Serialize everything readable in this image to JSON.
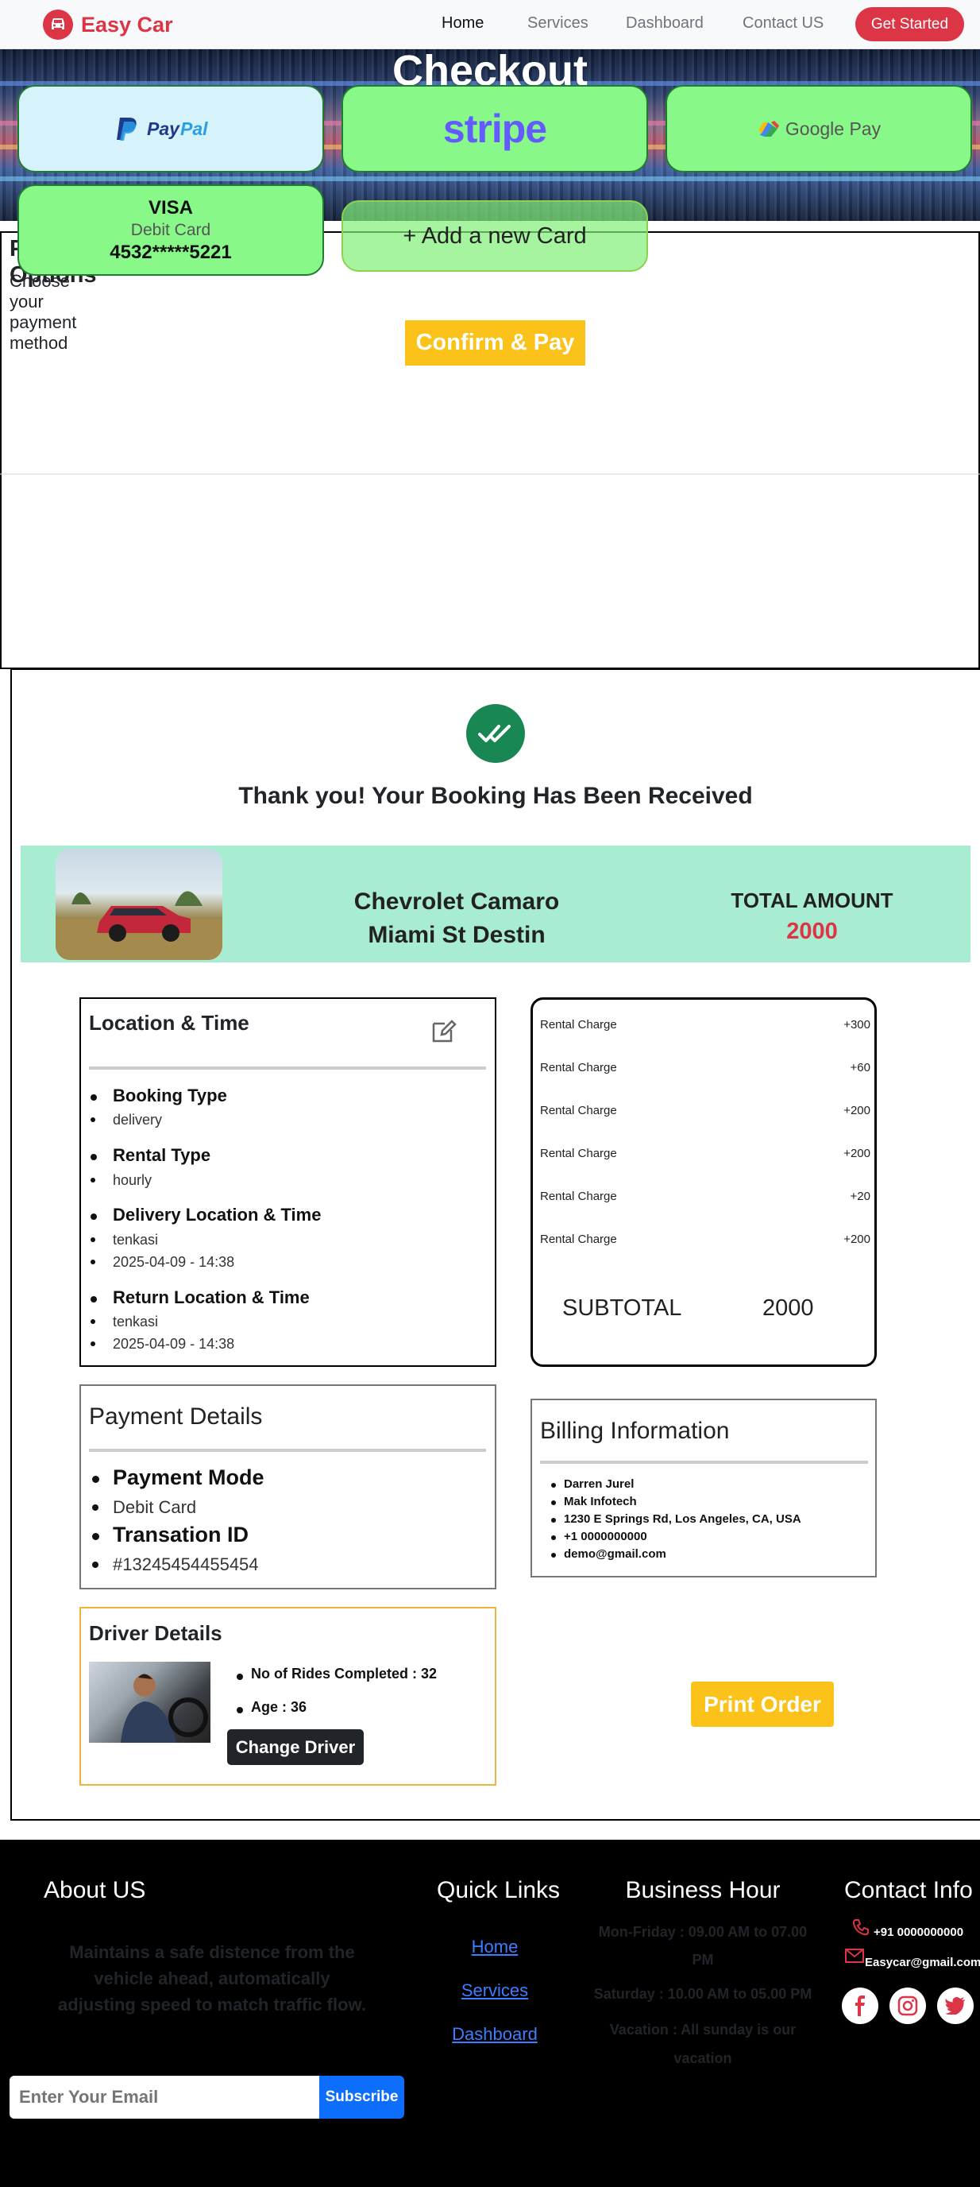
{
  "nav": {
    "brand": "Easy Car",
    "links": [
      "Home",
      "Services",
      "Dashboard",
      "Contact US"
    ],
    "cta": "Get Started"
  },
  "hero": {
    "title": "Checkout"
  },
  "payment": {
    "title": "Payment Options",
    "subtitle": "Choose your payment method",
    "methods": {
      "paypal": "PayPal",
      "stripe": "stripe",
      "gpay": "Google Pay"
    },
    "card": {
      "brand": "VISA",
      "type": "Debit Card",
      "number": "4532*****5221"
    },
    "add_card": "+ Add a new Card",
    "confirm": "Confirm & Pay"
  },
  "order": {
    "thanks": "Thank you! Your Booking Has Been Received",
    "car_name": "Chevrolet Camaro",
    "car_location": "Miami St Destin",
    "total_label": "TOTAL AMOUNT",
    "total_amount": "2000"
  },
  "location_time": {
    "title": "Location & Time",
    "sections": [
      {
        "heading": "Booking Type",
        "values": [
          "delivery"
        ]
      },
      {
        "heading": "Rental Type",
        "values": [
          "hourly"
        ]
      },
      {
        "heading": "Delivery Location & Time",
        "values": [
          "tenkasi",
          "2025-04-09 - 14:38"
        ]
      },
      {
        "heading": "Return Location & Time",
        "values": [
          "tenkasi",
          "2025-04-09 - 14:38"
        ]
      }
    ]
  },
  "charges": {
    "rows": [
      {
        "label": "Rental Charge",
        "value": "+300"
      },
      {
        "label": "Rental Charge",
        "value": "+60"
      },
      {
        "label": "Rental Charge",
        "value": "+200"
      },
      {
        "label": "Rental Charge",
        "value": "+200"
      },
      {
        "label": "Rental Charge",
        "value": "+20"
      },
      {
        "label": "Rental Charge",
        "value": "+200"
      }
    ],
    "subtotal_label": "SUBTOTAL",
    "subtotal_value": "2000"
  },
  "payment_details": {
    "title": "Payment Details",
    "mode_label": "Payment Mode",
    "mode_value": "Debit Card",
    "txn_label": "Transation ID",
    "txn_value": "#13245454455454"
  },
  "billing": {
    "title": "Billing Information",
    "lines": [
      "Darren Jurel",
      "Mak Infotech",
      "1230 E Springs Rd, Los Angeles, CA, USA",
      "+1 0000000000",
      "demo@gmail.com"
    ]
  },
  "driver": {
    "title": "Driver Details",
    "rides": "No of Rides Completed : 32",
    "age": "Age : 36",
    "change": "Change Driver"
  },
  "print": "Print Order",
  "footer": {
    "about_title": "About US",
    "about_text": "Maintains a safe distence from the vehicle ahead, automatically adjusting speed to match traffic flow.",
    "links_title": "Quick Links",
    "links": [
      "Home",
      "Services",
      "Dashboard"
    ],
    "hours_title": "Business Hour",
    "hours": [
      "Mon-Friday : 09.00 AM to 07.00",
      "PM",
      "Saturday : 10.00 AM to 05.00 PM",
      "Vacation : All sunday is our",
      "vacation"
    ],
    "contact_title": "Contact Info",
    "phone": "+91 0000000000",
    "email": "Easycar@gmail.com",
    "email_placeholder": "Enter Your Email",
    "subscribe": "Subscribe"
  },
  "colors": {
    "brand_red": "#dc3545",
    "accent_yellow": "#fbc21a",
    "card_green": "#88f888",
    "success_green": "#198754",
    "link_blue": "#3d7dff"
  }
}
